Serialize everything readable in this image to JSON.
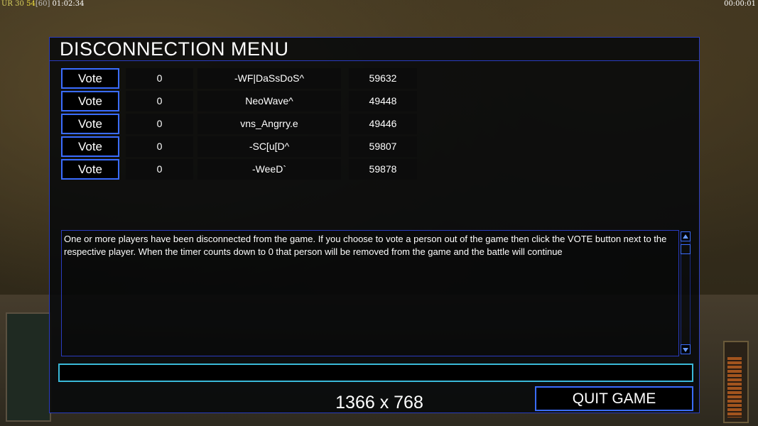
{
  "hud": {
    "ur_label": "UR",
    "value_a": "30",
    "value_b": "54",
    "fps": "[60]",
    "elapsed": "01:02:34",
    "timer_right": "00:00:01"
  },
  "dialog": {
    "title": "DISCONNECTION MENU",
    "vote_label": "Vote",
    "players": [
      {
        "votes": "0",
        "name": "-WF|DaSsDoS^",
        "ping": "59632"
      },
      {
        "votes": "0",
        "name": "NeoWave^",
        "ping": "49448"
      },
      {
        "votes": "0",
        "name": "vns_Angrry.e",
        "ping": "49446"
      },
      {
        "votes": "0",
        "name": "-SC[u[D^",
        "ping": "59807"
      },
      {
        "votes": "0",
        "name": "-WeeD`",
        "ping": "59878"
      }
    ],
    "message": "One or more players have been disconnected from the game. If you choose to vote a person out of the game then click the VOTE button next to the respective player. When the timer counts down to 0 that person will be removed from the game and the battle will continue",
    "chat_value": "",
    "resolution": "1366 x 768",
    "quit_label": "QUIT GAME"
  },
  "colors": {
    "border_blue": "#2a3cc0",
    "button_blue": "#3a6cff",
    "input_cyan": "#3ab8d8"
  }
}
